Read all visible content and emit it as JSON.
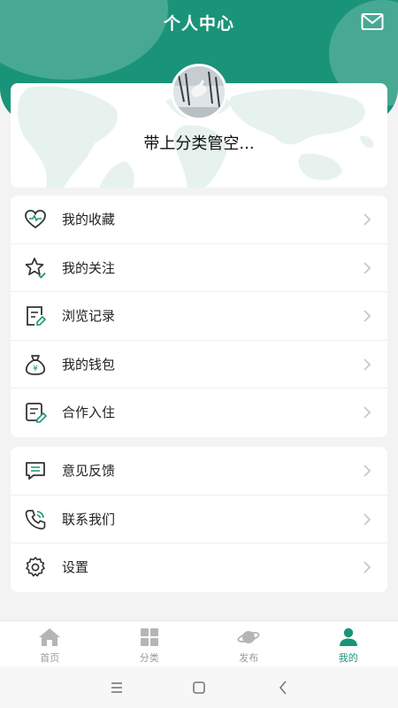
{
  "header": {
    "title": "个人中心",
    "mail_icon": "mail-icon"
  },
  "profile": {
    "username": "带上分类管空...",
    "avatar_icon": "avatar-photo"
  },
  "colors": {
    "primary": "#1a9478",
    "icon_dark": "#333333",
    "accent_small": "#1a9478",
    "chevron": "#c8c8c8"
  },
  "menu_group_1": [
    {
      "label": "我的收藏",
      "icon": "heart-pulse-icon"
    },
    {
      "label": "我的关注",
      "icon": "star-check-icon"
    },
    {
      "label": "浏览记录",
      "icon": "document-edit-icon"
    },
    {
      "label": "我的钱包",
      "icon": "money-bag-icon"
    },
    {
      "label": "合作入住",
      "icon": "note-pencil-icon"
    }
  ],
  "menu_group_2": [
    {
      "label": "意见反馈",
      "icon": "chat-bubble-icon"
    },
    {
      "label": "联系我们",
      "icon": "phone-icon"
    },
    {
      "label": "设置",
      "icon": "gear-icon"
    }
  ],
  "tabbar": {
    "items": [
      {
        "label": "首页",
        "icon": "home-icon",
        "active": false
      },
      {
        "label": "分类",
        "icon": "grid-icon",
        "active": false
      },
      {
        "label": "发布",
        "icon": "planet-icon",
        "active": false
      },
      {
        "label": "我的",
        "icon": "user-icon",
        "active": true
      }
    ]
  },
  "system_nav": {
    "menu": "menu-icon",
    "home": "square-icon",
    "back": "back-chevron-icon"
  }
}
